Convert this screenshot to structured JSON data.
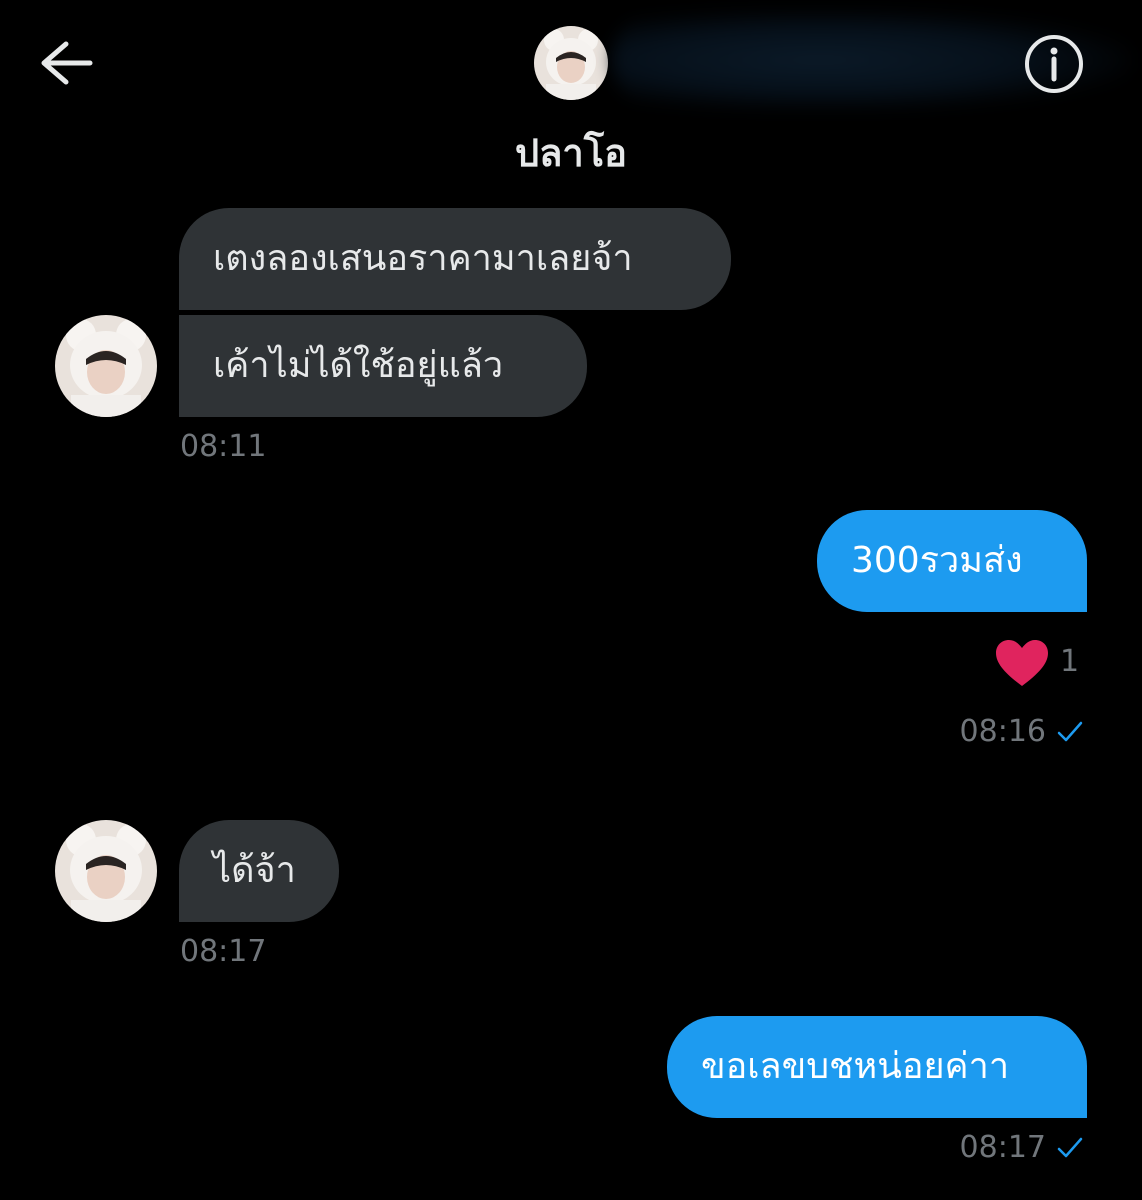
{
  "header": {
    "contact_name": "ปลาโอ",
    "back_icon": "arrow-left-icon",
    "info_icon": "info-icon"
  },
  "messages": [
    {
      "direction": "incoming",
      "text": "เตงลองเสนอราคามาเลยจ้า"
    },
    {
      "direction": "incoming",
      "text": "เค้าไม่ได้ใช้อยู่แล้ว",
      "time": "08:11"
    },
    {
      "direction": "outgoing",
      "text": "300รวมส่ง",
      "reaction": {
        "icon": "heart-icon",
        "count": "1"
      },
      "time": "08:16",
      "status": "sent"
    },
    {
      "direction": "incoming",
      "text": "ได้จ้า",
      "time": "08:17"
    },
    {
      "direction": "outgoing",
      "text": "ขอเลขบชหน่อยค่าา",
      "time": "08:17",
      "status": "sent"
    }
  ],
  "colors": {
    "background": "#000000",
    "incoming_bubble": "#2f3336",
    "outgoing_bubble": "#1d9bf0",
    "timestamp": "#71767b",
    "checkmark": "#1d9bf0",
    "heart": "#f91880"
  }
}
